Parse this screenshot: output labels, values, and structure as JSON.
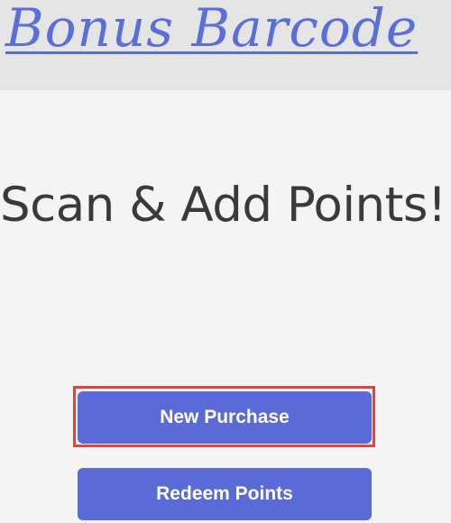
{
  "header": {
    "title": "Bonus Barcode"
  },
  "main": {
    "headline": "Scan & Add Points!"
  },
  "actions": {
    "new_purchase_label": "New Purchase",
    "redeem_points_label": "Redeem Points"
  },
  "colors": {
    "accent": "#5a6ad6",
    "title": "#5a6fd8",
    "highlight": "#e0443e",
    "header_bg": "#e5e5e5",
    "page_bg": "#f4f4f4"
  }
}
